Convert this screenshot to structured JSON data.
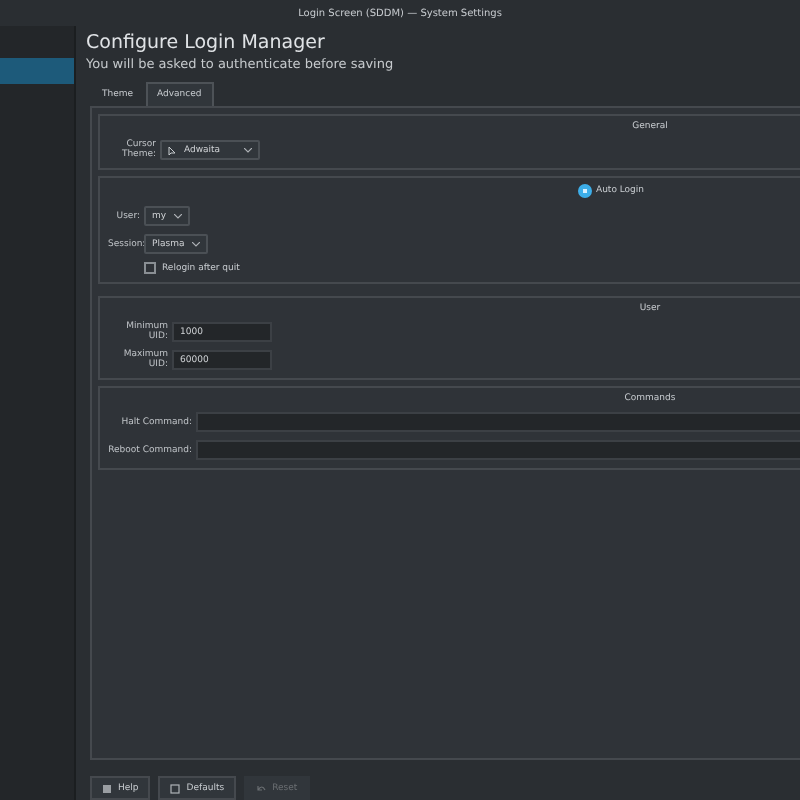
{
  "window": {
    "title": "Login Screen (SDDM) — System Settings"
  },
  "sidebar": {
    "items": [
      {
        "selected": true
      }
    ]
  },
  "header": {
    "title": "Configure Login Manager",
    "subtitle": "You will be asked to authenticate before saving"
  },
  "tabs": [
    {
      "label": "Theme",
      "selected": false
    },
    {
      "label": "Advanced",
      "selected": true
    }
  ],
  "general": {
    "title": "General",
    "cursor_theme_label": "Cursor Theme:",
    "cursor_theme_value": "Adwaita"
  },
  "auto_login": {
    "label": "Auto Login",
    "checked": true,
    "user_label": "User:",
    "user_value": "my",
    "session_label": "Session:",
    "session_value": "Plasma",
    "relogin_label": "Relogin after quit",
    "relogin_checked": false
  },
  "user": {
    "title": "User",
    "fields": [
      {
        "label": "Minimum UID:",
        "value": "1000"
      },
      {
        "label": "Maximum UID:",
        "value": "60000"
      }
    ]
  },
  "commands": {
    "title": "Commands",
    "fields": [
      {
        "label": "Halt Command:"
      },
      {
        "label": "Reboot Command:"
      }
    ]
  },
  "buttons": [
    {
      "label": "Help",
      "disabled": false
    },
    {
      "label": "Defaults",
      "disabled": false
    },
    {
      "label": "Reset",
      "disabled": true
    }
  ]
}
